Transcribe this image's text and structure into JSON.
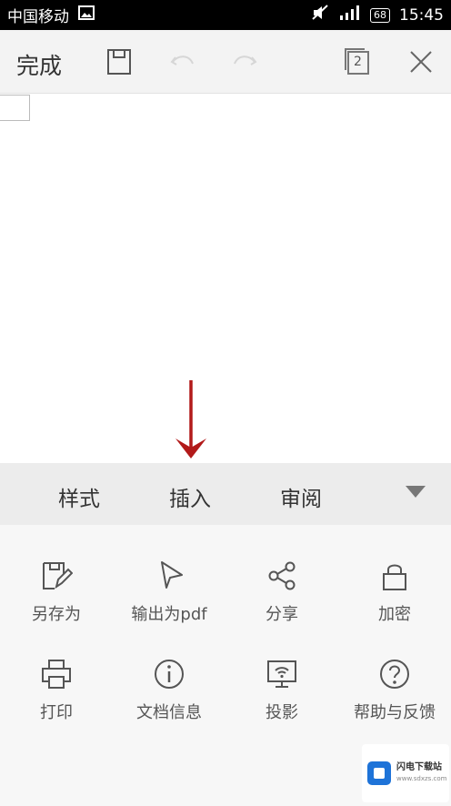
{
  "status_bar": {
    "carrier": "中国移动",
    "battery": "68",
    "time": "15:45",
    "icons": [
      "image-icon",
      "mute-icon",
      "signal-icon",
      "battery-icon"
    ]
  },
  "toolbar": {
    "done_label": "完成",
    "icons": [
      "save-icon",
      "undo-icon",
      "redo-icon",
      "page-count-icon",
      "close-icon"
    ],
    "page_count": "2"
  },
  "tabs": {
    "items": [
      "样式",
      "插入",
      "审阅"
    ],
    "expand_icon": "caret-down-icon"
  },
  "annotation": {
    "arrow_color": "#b21a1a"
  },
  "menu": {
    "items": [
      {
        "label": "另存为",
        "icon": "save-as-icon"
      },
      {
        "label": "输出为pdf",
        "icon": "export-pdf-icon"
      },
      {
        "label": "分享",
        "icon": "share-icon"
      },
      {
        "label": "加密",
        "icon": "lock-icon"
      },
      {
        "label": "打印",
        "icon": "printer-icon"
      },
      {
        "label": "文档信息",
        "icon": "info-icon"
      },
      {
        "label": "投影",
        "icon": "projection-icon"
      },
      {
        "label": "帮助与反馈",
        "icon": "help-icon"
      }
    ]
  },
  "watermark": {
    "text": "闪电下载站",
    "subtext": "www.sdxzs.com"
  }
}
